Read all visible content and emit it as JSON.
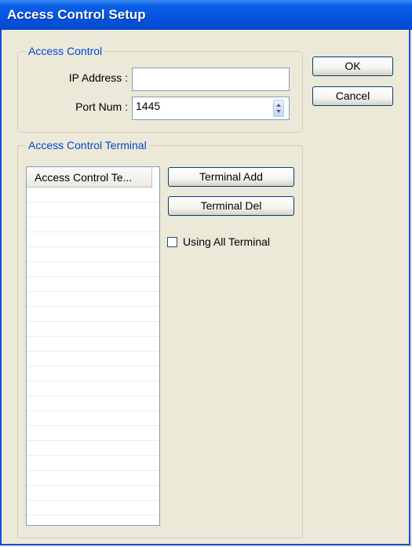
{
  "window": {
    "title": "Access Control Setup"
  },
  "access_control_group": {
    "legend": "Access Control",
    "ip_label": "IP Address :",
    "ip_value": "",
    "port_label": "Port Num :",
    "port_value": "1445"
  },
  "buttons": {
    "ok": "OK",
    "cancel": "Cancel"
  },
  "terminal_group": {
    "legend": "Access Control Terminal",
    "list_header": "Access Control Te...",
    "add_button": "Terminal Add",
    "del_button": "Terminal Del",
    "using_all_label": "Using All Terminal",
    "using_all_checked": false,
    "rows": []
  }
}
